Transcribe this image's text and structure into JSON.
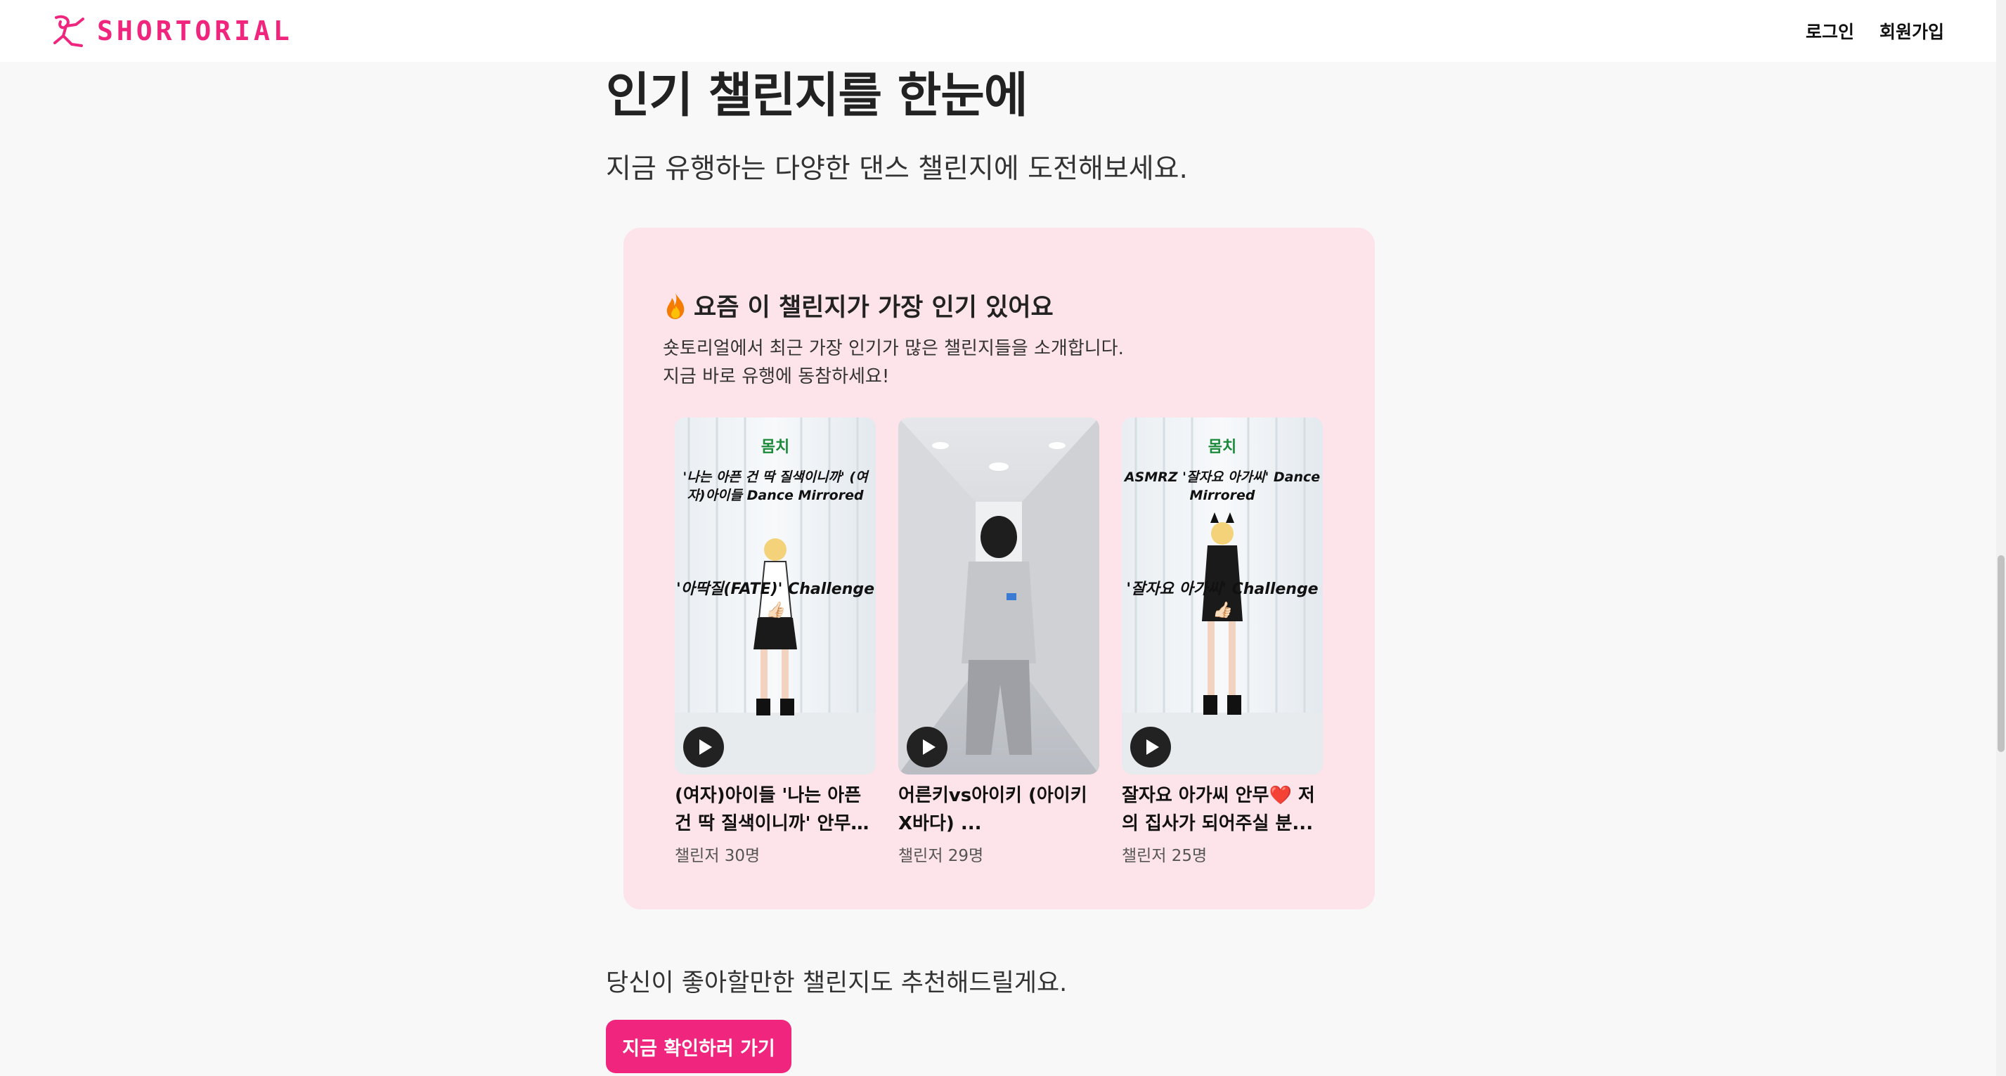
{
  "header": {
    "brand": "SHORTORIAL",
    "login_label": "로그인",
    "signup_label": "회원가입"
  },
  "hero": {
    "title": "인기 챌린지를 한눈에",
    "subtitle": "지금 유행하는 다양한 댄스 챌린지에 도전해보세요."
  },
  "popular": {
    "title": "요즘 이 챌린지가 가장 인기 있어요",
    "desc_line1": "숏토리얼에서 최근 가장 인기가 많은 챌린지들을 소개합니다.",
    "desc_line2": "지금 바로 유행에 동참하세요!",
    "challenges": [
      {
        "title": "(여자)아이들 '나는 아픈 건 딱 질색이니까' 안무❤️ ...",
        "count": "챌린저 30명",
        "overlay_top": "'나는 아픈 건 딱 질색이니까' (여자)아이들 Dance Mirrored",
        "overlay_mid": "'아딱질(FATE)' Challenge👍🏻"
      },
      {
        "title": "어른키vs아이키 (아이키X바다) ...",
        "count": "챌린저 29명"
      },
      {
        "title": "잘자요 아가씨 안무❤️ 저의 집사가 되어주실 분...",
        "count": "챌린저 25명",
        "overlay_top": "ASMRZ '잘자요 아가씨' Dance Mirrored",
        "overlay_mid": "'잘자요 아가씨' Challenge👍🏻"
      }
    ]
  },
  "recommend": {
    "text": "당신이 좋아할만한 챌린지도 추천해드릴게요.",
    "button_label": "지금 확인하러 가기"
  },
  "colors": {
    "brand_pink": "#f0257d",
    "card_bg": "#fde3ea",
    "page_bg": "#f8f8f8"
  }
}
